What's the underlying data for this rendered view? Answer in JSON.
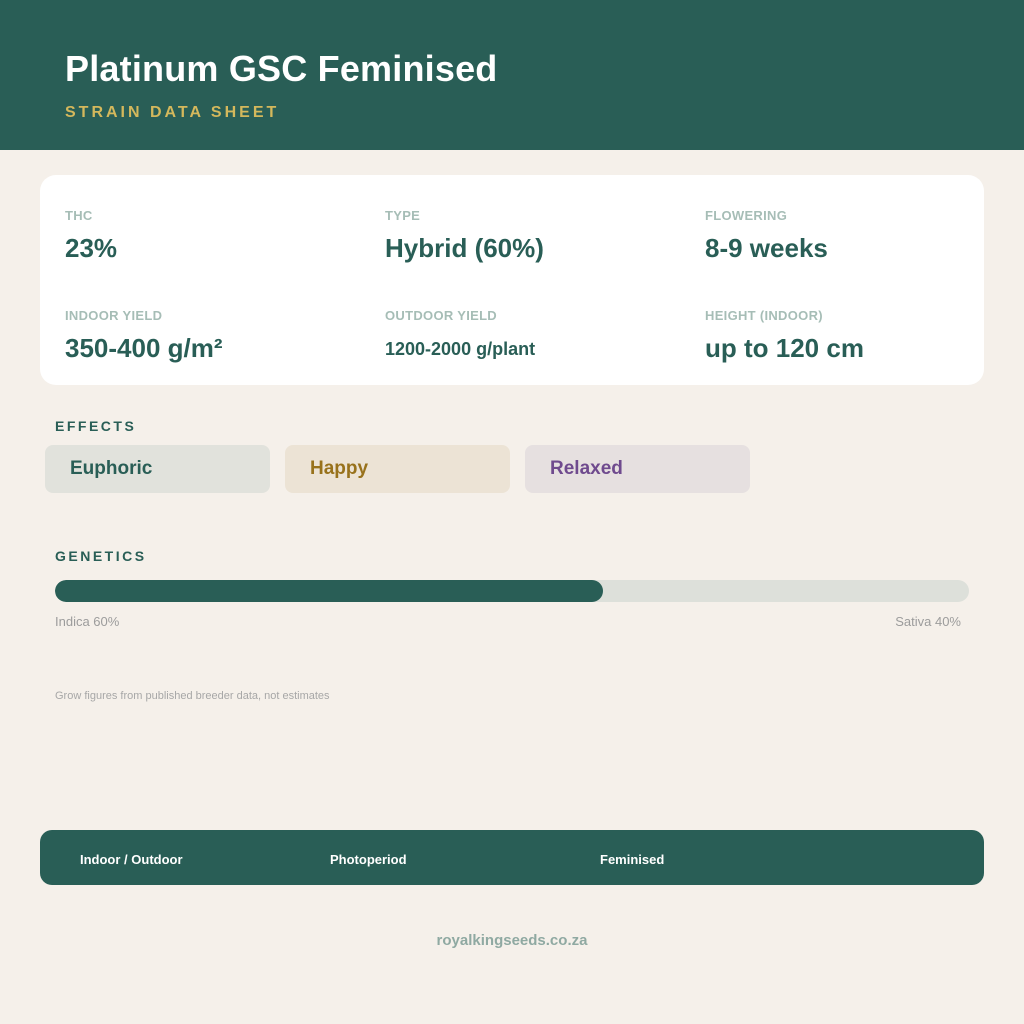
{
  "header": {
    "title": "Platinum GSC Feminised",
    "subtitle": "STRAIN DATA SHEET"
  },
  "stats": [
    {
      "label": "THC",
      "value": "23%"
    },
    {
      "label": "TYPE",
      "value": "Hybrid (60%)"
    },
    {
      "label": "FLOWERING",
      "value": "8-9 weeks"
    },
    {
      "label": "INDOOR YIELD",
      "value": "350-400 g/m²"
    },
    {
      "label": "OUTDOOR YIELD",
      "value": "1200-2000 g/plant"
    },
    {
      "label": "HEIGHT (INDOOR)",
      "value": "up to 120 cm"
    }
  ],
  "effects": {
    "heading": "EFFECTS",
    "items": [
      "Euphoric",
      "Happy",
      "Relaxed"
    ]
  },
  "genetics": {
    "heading": "GENETICS",
    "indica_label": "Indica 60%",
    "sativa_label": "Sativa 40%",
    "indica_fraction": 0.6
  },
  "note": "Grow figures from published breeder data, not estimates",
  "footer": {
    "items": [
      "Indoor / Outdoor",
      "Photoperiod",
      "Feminised"
    ]
  },
  "site": "royalkingseeds.co.za",
  "colors": {
    "primary": "#295e56",
    "accent_gold": "#d4b85c",
    "background": "#f5f0ea",
    "happy": "#98721c",
    "relaxed": "#6f4a8e"
  }
}
